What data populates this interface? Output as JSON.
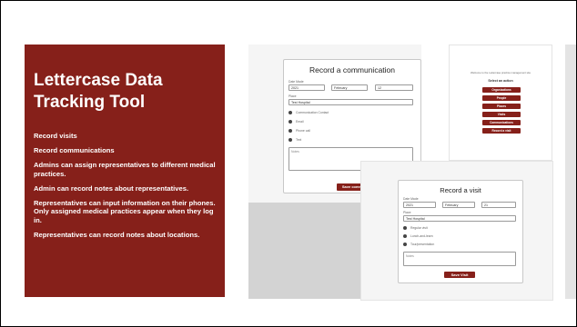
{
  "slide": {
    "title": "Lettercase Data Tracking Tool",
    "bullets": [
      "Record visits",
      "Record communications",
      "Admins can assign representatives to different medical practices.",
      "Admin can record notes about representatives.",
      "Representatives can input information on their phones. Only assigned medical practices appear when they log in.",
      "Representatives can record notes about locations."
    ],
    "accent_color": "#86201a"
  },
  "communication_screen": {
    "title": "Record a communication",
    "date_label": "Date Made",
    "year": "2021",
    "month": "February",
    "day": "12",
    "place_label": "Place",
    "place_value": "Test Hospital",
    "options": [
      "Communication Contact",
      "Email",
      "Phone call",
      "Text"
    ],
    "notes_placeholder": "Notes",
    "save_label": "Save comm"
  },
  "menu_screen": {
    "intro": "Welcome to the Lettercase practice management site",
    "heading": "Select an action",
    "buttons": [
      "Organizations",
      "People",
      "Places",
      "Visits",
      "Communications",
      "Record a visit"
    ]
  },
  "visit_screen": {
    "title": "Record a visit",
    "date_label": "Date Made",
    "year": "2021",
    "month": "February",
    "day": "21",
    "place_label": "Place",
    "place_value": "Test Hospital",
    "options": [
      "Regular visit",
      "Lunch-and-learn",
      "Tour/presentation"
    ],
    "notes_placeholder": "Notes",
    "save_label": "Save Visit"
  }
}
